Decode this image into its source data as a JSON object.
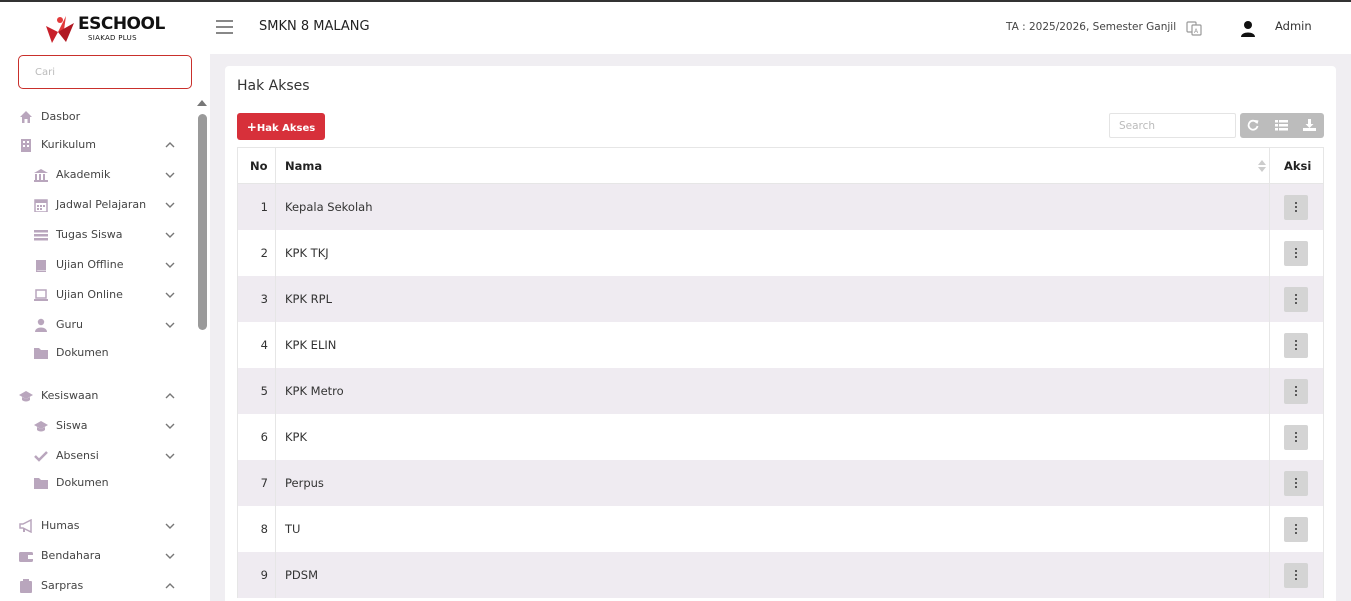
{
  "header": {
    "logo_text": "ESCHOOL",
    "logo_sub": "SIAKAD PLUS",
    "school_name": "SMKN 8 MALANG",
    "ta": "TA : 2025/2026, Semester Ganjil",
    "user": "Admin"
  },
  "sidebar": {
    "search_placeholder": "Cari",
    "items": [
      {
        "label": "Dasbor",
        "icon": "home-icon"
      },
      {
        "label": "Kurikulum",
        "icon": "building-icon",
        "chevron": "up"
      },
      {
        "label": "Akademik",
        "icon": "institution-icon",
        "chevron": "down",
        "sub": true
      },
      {
        "label": "Jadwal Pelajaran",
        "icon": "calendar-icon",
        "chevron": "down",
        "sub": true
      },
      {
        "label": "Tugas Siswa",
        "icon": "tasks-icon",
        "chevron": "down",
        "sub": true
      },
      {
        "label": "Ujian Offline",
        "icon": "book-icon",
        "chevron": "down",
        "sub": true
      },
      {
        "label": "Ujian Online",
        "icon": "laptop-icon",
        "chevron": "down",
        "sub": true
      },
      {
        "label": "Guru",
        "icon": "user-icon",
        "chevron": "down",
        "sub": true
      },
      {
        "label": "Dokumen",
        "icon": "folder-icon",
        "sub": true
      },
      {
        "label": "Kesiswaan",
        "icon": "graduation-cap-icon",
        "chevron": "up"
      },
      {
        "label": "Siswa",
        "icon": "graduation-cap-icon",
        "chevron": "down",
        "sub": true
      },
      {
        "label": "Absensi",
        "icon": "check-icon",
        "chevron": "down",
        "sub": true
      },
      {
        "label": "Dokumen",
        "icon": "folder-icon",
        "sub": true
      },
      {
        "label": "Humas",
        "icon": "bullhorn-icon",
        "chevron": "down"
      },
      {
        "label": "Bendahara",
        "icon": "wallet-icon",
        "chevron": "down"
      },
      {
        "label": "Sarpras",
        "icon": "clipboard-icon",
        "chevron": "up"
      }
    ]
  },
  "main": {
    "title": "Hak Akses",
    "add_button": "Hak Akses",
    "search_placeholder": "Search",
    "columns": {
      "no": "No",
      "nama": "Nama",
      "aksi": "Aksi"
    },
    "rows": [
      {
        "no": "1",
        "nama": "Kepala Sekolah"
      },
      {
        "no": "2",
        "nama": "KPK TKJ"
      },
      {
        "no": "3",
        "nama": "KPK RPL"
      },
      {
        "no": "4",
        "nama": "KPK ELIN"
      },
      {
        "no": "5",
        "nama": "KPK Metro"
      },
      {
        "no": "6",
        "nama": "KPK"
      },
      {
        "no": "7",
        "nama": "Perpus"
      },
      {
        "no": "8",
        "nama": "TU"
      },
      {
        "no": "9",
        "nama": "PDSM"
      }
    ]
  },
  "colors": {
    "accent": "#d7303a",
    "icon": "#b9a6bd",
    "row_alt": "#efebf1"
  }
}
